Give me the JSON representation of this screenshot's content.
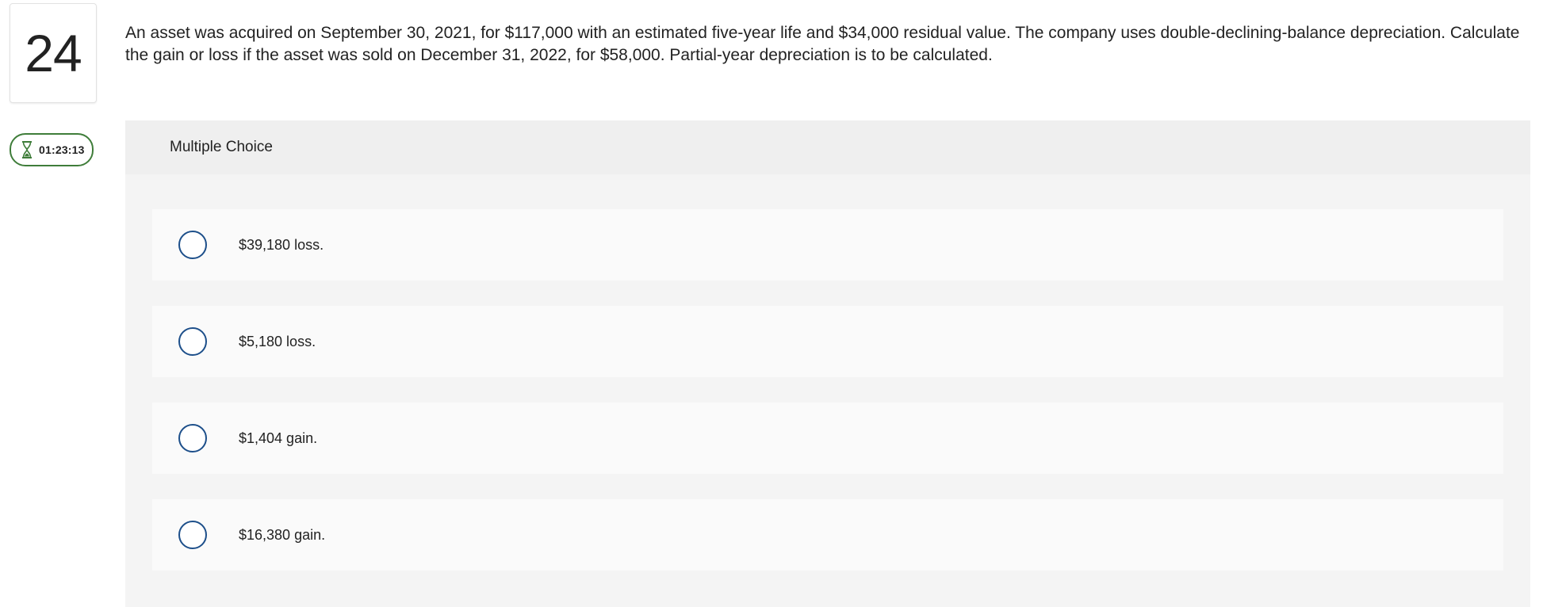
{
  "question": {
    "number": "24",
    "text": "An asset was acquired on September 30, 2021, for $117,000 with an estimated five-year life and $34,000 residual value. The company uses double-declining-balance depreciation. Calculate the gain or loss if the asset was sold on December 31, 2022, for $58,000. Partial-year depreciation is to be calculated."
  },
  "timer": {
    "icon": "hourglass-icon",
    "value": "01:23:13",
    "color": "#3f7d3a"
  },
  "answer_panel": {
    "header": "Multiple Choice",
    "choices": [
      {
        "label": "$39,180 loss."
      },
      {
        "label": "$5,180 loss."
      },
      {
        "label": "$1,404 gain."
      },
      {
        "label": "$16,380 gain."
      }
    ]
  },
  "colors": {
    "radio_border": "#1d4f8a",
    "panel_bg": "#f4f4f4",
    "choice_bg": "#fafafa"
  }
}
